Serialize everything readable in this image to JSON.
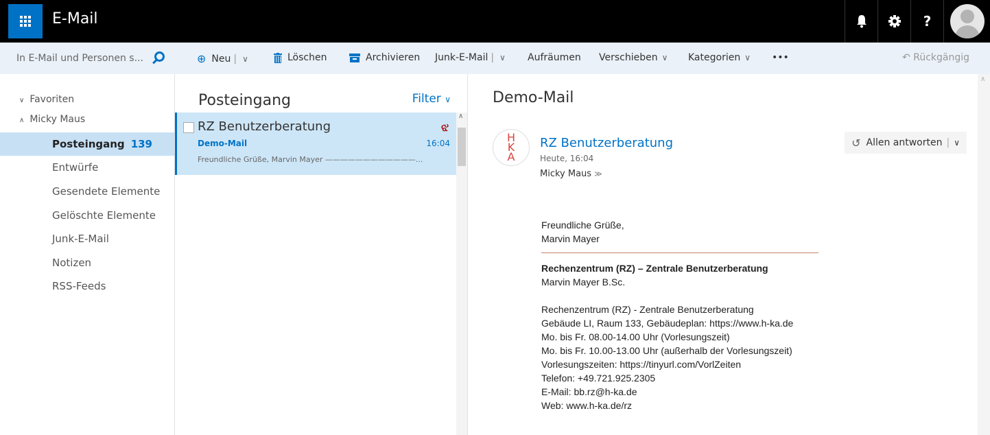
{
  "app": {
    "title": "E-Mail"
  },
  "topbar": {
    "icons": [
      "bell-icon",
      "gear-icon",
      "help-icon"
    ],
    "help_label": "?"
  },
  "search": {
    "placeholder": "In E-Mail und Personen s..."
  },
  "toolbar": {
    "new": "Neu",
    "delete": "Löschen",
    "archive": "Archivieren",
    "junk": "Junk-E-Mail",
    "sweep": "Aufräumen",
    "move": "Verschieben",
    "categories": "Kategorien",
    "more": "•••",
    "undo": "Rückgängig"
  },
  "folders": {
    "favorites": "Favoriten",
    "account": "Micky Maus",
    "items": [
      {
        "label": "Posteingang",
        "count": "139",
        "selected": true
      },
      {
        "label": "Entwürfe"
      },
      {
        "label": "Gesendete Elemente"
      },
      {
        "label": "Gelöschte Elemente"
      },
      {
        "label": "Junk-E-Mail"
      },
      {
        "label": "Notizen"
      },
      {
        "label": "RSS-Feeds"
      }
    ]
  },
  "message_list": {
    "title": "Posteingang",
    "filter": "Filter",
    "messages": [
      {
        "sender": "RZ Benutzerberatung",
        "subject": "Demo-Mail",
        "time": "16:04",
        "preview": "Freundliche Grüße, Marvin Mayer ————————————..."
      }
    ]
  },
  "reading_pane": {
    "subject": "Demo-Mail",
    "sender": "RZ Benutzerberatung",
    "date": "Heute, 16:04",
    "recipient": "Micky Maus",
    "reply_all": "Allen antworten",
    "logo_letters": [
      "H",
      "K",
      "A"
    ],
    "body": {
      "greeting": "Freundliche Grüße,",
      "name": "Marvin Mayer",
      "org_bold": "Rechenzentrum (RZ) – Zentrale Benutzerberatung",
      "person": "Marvin Mayer B.Sc.",
      "lines": [
        "Rechenzentrum (RZ) - Zentrale Benutzerberatung",
        "Gebäude LI, Raum 133, Gebäudeplan: https://www.h-ka.de",
        "Mo. bis Fr. 08.00-14.00 Uhr (Vorlesungszeit)",
        "Mo. bis Fr. 10.00-13.00 Uhr (außerhalb der Vorlesungszeit)",
        "Vorlesungszeiten: https://tinyurl.com/VorlZeiten",
        "Telefon: +49.721.925.2305",
        "E-Mail: bb.rz@h-ka.de",
        "Web: www.h-ka.de/rz"
      ]
    }
  },
  "colors": {
    "accent": "#0072c6",
    "topbar": "#000000",
    "command_bar": "#eaf1f8",
    "selected": "#cde6f7",
    "flag": "#a80000",
    "logo": "#d64541"
  }
}
